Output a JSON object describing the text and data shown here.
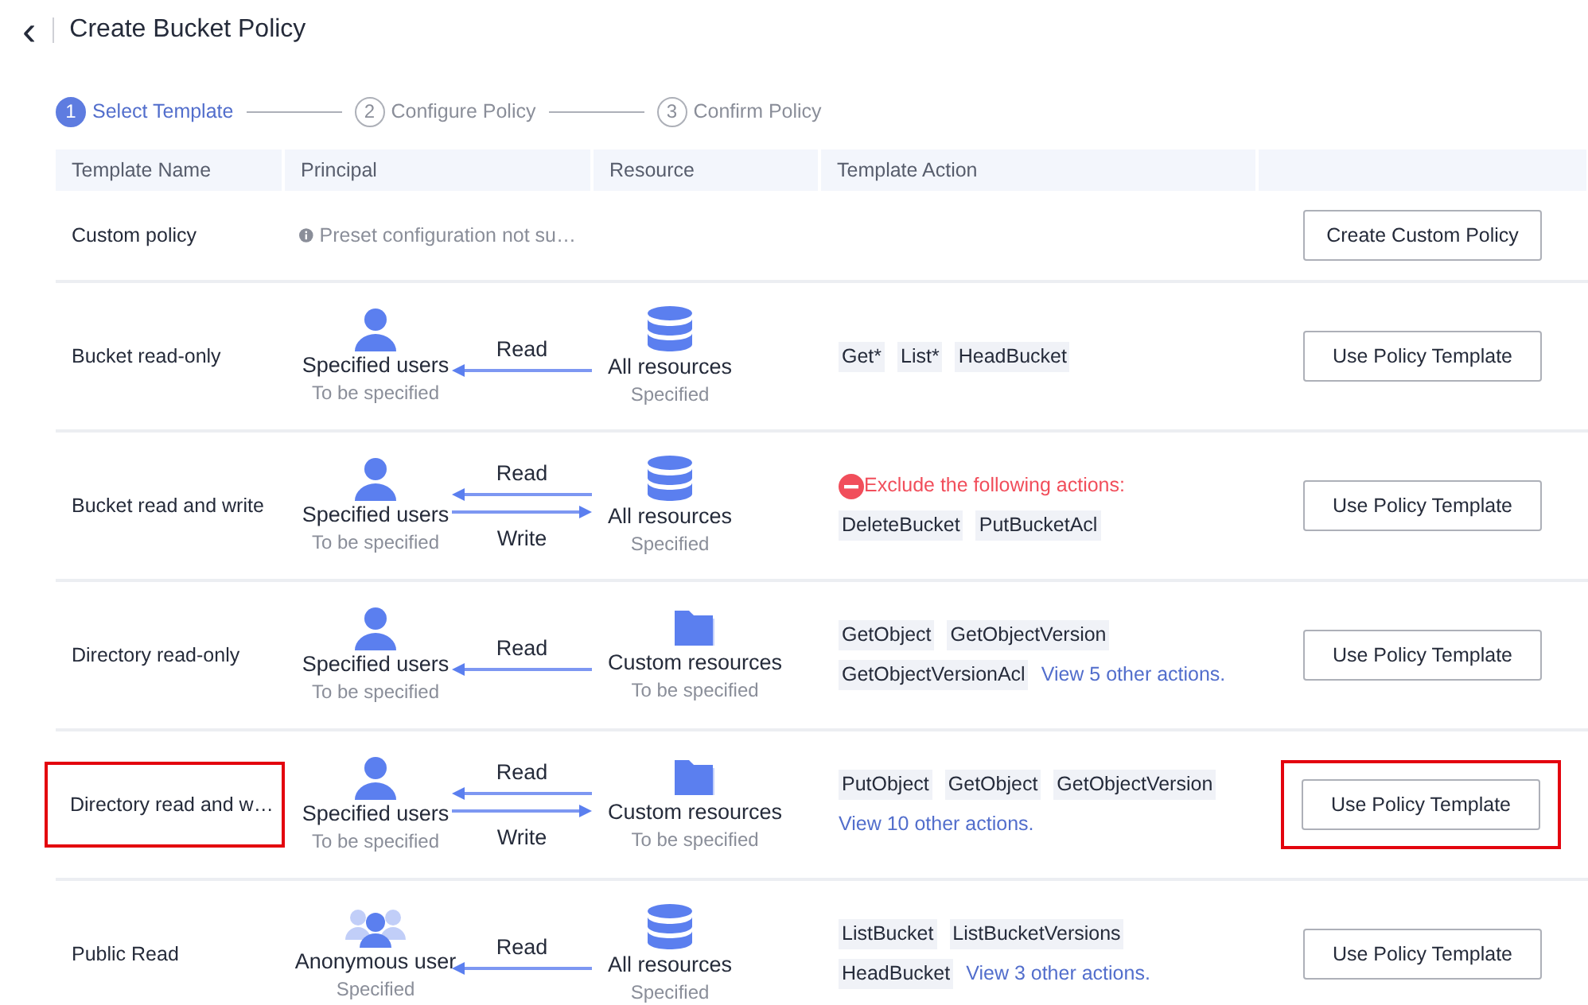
{
  "header": {
    "back": "‹",
    "title": "Create Bucket Policy"
  },
  "steps": [
    {
      "number": "1",
      "label": "Select Template",
      "selected": true
    },
    {
      "number": "2",
      "label": "Configure Policy",
      "selected": false
    },
    {
      "number": "3",
      "label": "Confirm Policy",
      "selected": false
    }
  ],
  "table": {
    "columns": [
      "Template Name",
      "Principal",
      "Resource",
      "Template Action"
    ],
    "rows": [
      {
        "kind": "custom",
        "name": "Custom policy",
        "highlighted": false,
        "note": "Preset configuration not su…",
        "button": "Create Custom Policy"
      },
      {
        "kind": "template",
        "name": "Bucket read-only",
        "highlighted": false,
        "principal": {
          "kind": "users",
          "label": "Specified users",
          "sub": "To be specified"
        },
        "arrows": [
          {
            "label": "Read",
            "kind": "left"
          }
        ],
        "resource": {
          "kind": "database",
          "label": "All resources",
          "sub": "Specified"
        },
        "actions": {
          "tags": [
            "Get*",
            "List*",
            "HeadBucket"
          ]
        },
        "button": "Use Policy Template"
      },
      {
        "kind": "template",
        "name": "Bucket read and write",
        "highlighted": false,
        "principal": {
          "kind": "users",
          "label": "Specified users",
          "sub": "To be specified"
        },
        "arrows": [
          {
            "label": "Read",
            "kind": "left"
          },
          {
            "label": "Write",
            "kind": "right"
          }
        ],
        "resource": {
          "kind": "database",
          "label": "All resources",
          "sub": "Specified"
        },
        "actions": {
          "exclude": "Exclude the following actions:",
          "tags": [
            "DeleteBucket",
            "PutBucketAcl"
          ]
        },
        "button": "Use Policy Template"
      },
      {
        "kind": "template",
        "name": "Directory read-only",
        "highlighted": false,
        "principal": {
          "kind": "users",
          "label": "Specified users",
          "sub": "To be specified"
        },
        "arrows": [
          {
            "label": "Read",
            "kind": "left"
          }
        ],
        "resource": {
          "kind": "folder",
          "label": "Custom resources",
          "sub": "To be specified"
        },
        "actions": {
          "tags": [
            "GetObject",
            "GetObjectVersion",
            "GetObjectVersionAcl"
          ],
          "more": "View 5 other actions."
        },
        "button": "Use Policy Template"
      },
      {
        "kind": "template",
        "name": "Directory read and w…",
        "highlighted": true,
        "principal": {
          "kind": "users",
          "label": "Specified users",
          "sub": "To be specified"
        },
        "arrows": [
          {
            "label": "Read",
            "kind": "left"
          },
          {
            "label": "Write",
            "kind": "right"
          }
        ],
        "resource": {
          "kind": "folder",
          "label": "Custom resources",
          "sub": "To be specified"
        },
        "actions": {
          "tags": [
            "PutObject",
            "GetObject",
            "GetObjectVersion"
          ],
          "more": "View 10 other actions."
        },
        "button": "Use Policy Template"
      },
      {
        "kind": "template",
        "name": "Public Read",
        "highlighted": false,
        "principal": {
          "kind": "anonymous",
          "label": "Anonymous user",
          "sub": "Specified"
        },
        "arrows": [
          {
            "label": "Read",
            "kind": "left"
          }
        ],
        "resource": {
          "kind": "database",
          "label": "All resources",
          "sub": "Specified"
        },
        "actions": {
          "tags": [
            "ListBucket",
            "ListBucketVersions",
            "HeadBucket"
          ],
          "more": "View 3 other actions."
        },
        "button": "Use Policy Template"
      }
    ]
  }
}
